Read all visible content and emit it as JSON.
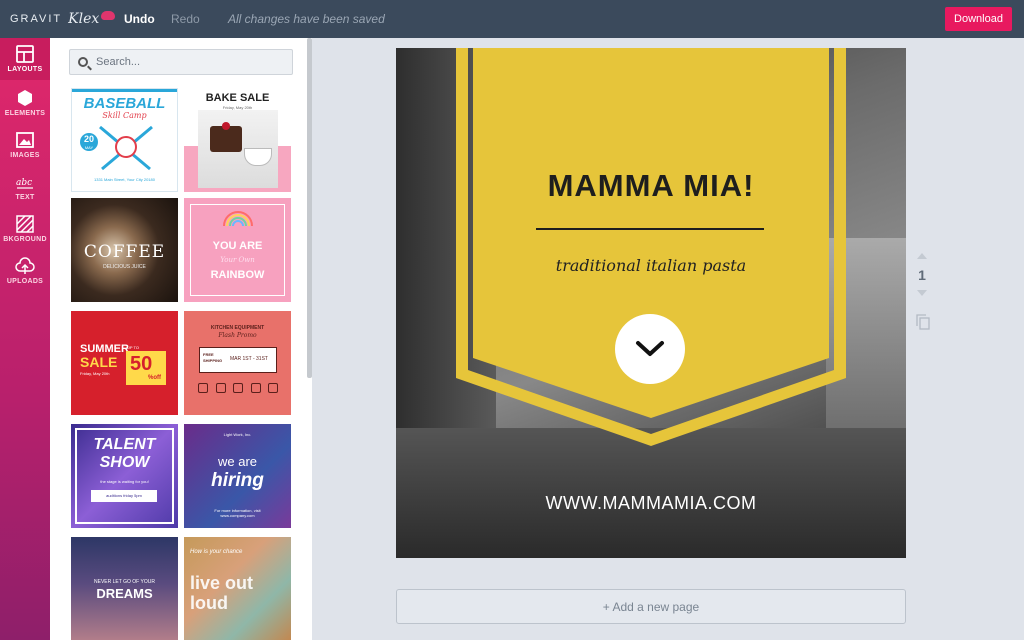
{
  "app": {
    "brand": "GRAVIT",
    "script_name": "Klex"
  },
  "toolbar": {
    "undo_label": "Undo",
    "redo_label": "Redo",
    "status": "All changes have been saved",
    "download_label": "Download",
    "accent": "#e8195f"
  },
  "rail": {
    "items": [
      {
        "label": "LAYOUTS",
        "icon": "layout-icon",
        "active": true
      },
      {
        "label": "ELEMENTS",
        "icon": "shapes-icon",
        "active": false
      },
      {
        "label": "IMAGES",
        "icon": "image-icon",
        "active": false
      },
      {
        "label": "TEXT",
        "icon": "text-icon",
        "active": false
      },
      {
        "label": "BKGROUND",
        "icon": "background-icon",
        "active": false
      },
      {
        "label": "UPLOADS",
        "icon": "upload-icon",
        "active": false
      }
    ]
  },
  "panel": {
    "search_placeholder": "Search...",
    "templates": {
      "baseball": {
        "title": "BASEBALL",
        "subtitle": "Skill Camp",
        "day": "20",
        "month": "MAY",
        "foot": "1331 Main Street, Your City 20180"
      },
      "bake": {
        "title": "BAKE SALE",
        "sub": "Friday, May 20th"
      },
      "coffee": {
        "title": "COFFEE",
        "sub": "DELICIOUS JUICE"
      },
      "rainbow": {
        "line1": "YOU ARE",
        "line2": "Your Own",
        "line3": "RAINBOW"
      },
      "summer": {
        "line1": "SUMMER",
        "line2": "SALE",
        "upto": "UP TO",
        "pct": "50",
        "off": "%off",
        "date": "Friday, May 20th"
      },
      "kitchen": {
        "line1": "KITCHEN EQUIPMENT",
        "line2": "Flash Promo",
        "free": "FREE SHIPPING",
        "date": "MAR 1ST - 31ST"
      },
      "talent": {
        "line1": "TALENT",
        "line2": "SHOW",
        "line3": "the stage is waiting for you!",
        "line4": "auditions friday 5pm"
      },
      "hiring": {
        "top": "Light Work, Inc.",
        "line1": "we are",
        "line2": "hiring",
        "foot": "For more information, visit www.company.com"
      },
      "dreams": {
        "line1": "NEVER LET GO OF YOUR",
        "line2": "DREAMS"
      },
      "liveout": {
        "line1": "How is your chance",
        "line2": "live out",
        "line3": "loud"
      }
    }
  },
  "canvas": {
    "title": "MAMMA MIA!",
    "subtitle": "traditional italian pasta",
    "url": "WWW.MAMMAMIA.COM",
    "banner_color": "#e6c53a"
  },
  "pagenav": {
    "current": "1"
  },
  "add_page_label": "+ Add a new page"
}
